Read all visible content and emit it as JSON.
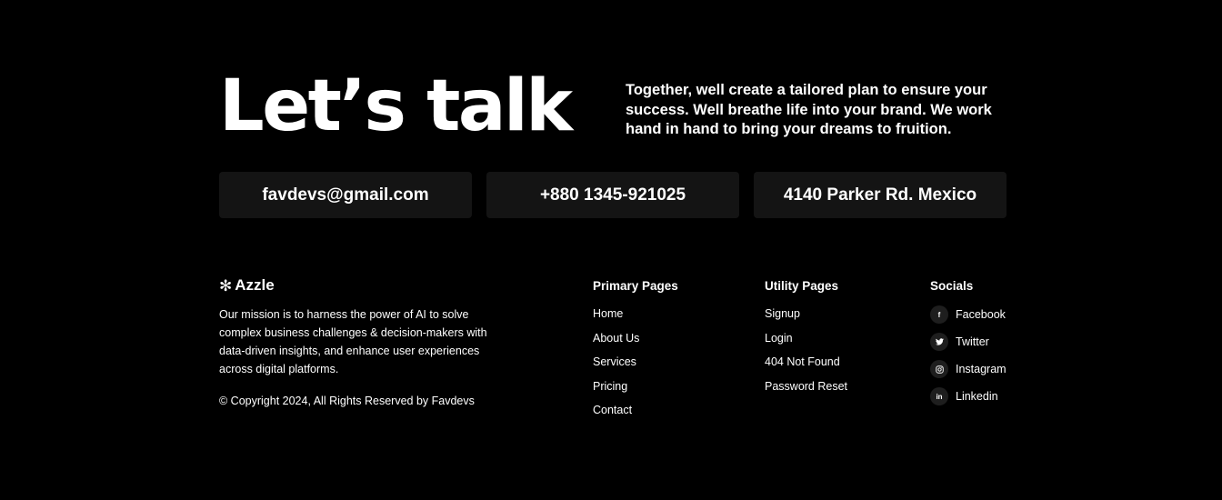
{
  "hero": {
    "title": "Let’s talk",
    "description": "Together, well create a tailored plan to ensure your success. Well breathe life into your brand. We work hand in hand to bring your dreams to fruition."
  },
  "contacts": {
    "email": "favdevs@gmail.com",
    "phone": "+880 1345-921025",
    "address": "4140 Parker Rd. Mexico"
  },
  "brand": {
    "icon": "asterisk-logo-icon",
    "name": "Azzle",
    "mission": "Our mission is to harness the power of AI to solve complex business challenges & decision-makers with data-driven insights, and enhance user experiences across digital platforms.",
    "copyright": "© Copyright 2024, All Rights Reserved by Favdevs"
  },
  "primary_pages": {
    "title": "Primary Pages",
    "links": [
      "Home",
      "About Us",
      "Services",
      "Pricing",
      "Contact"
    ]
  },
  "utility_pages": {
    "title": "Utility Pages",
    "links": [
      "Signup",
      "Login",
      "404 Not Found",
      "Password Reset"
    ]
  },
  "socials": {
    "title": "Socials",
    "items": [
      {
        "label": "Facebook",
        "icon": "facebook-icon"
      },
      {
        "label": "Twitter",
        "icon": "twitter-icon"
      },
      {
        "label": "Instagram",
        "icon": "instagram-icon"
      },
      {
        "label": "Linkedin",
        "icon": "linkedin-icon"
      }
    ]
  }
}
